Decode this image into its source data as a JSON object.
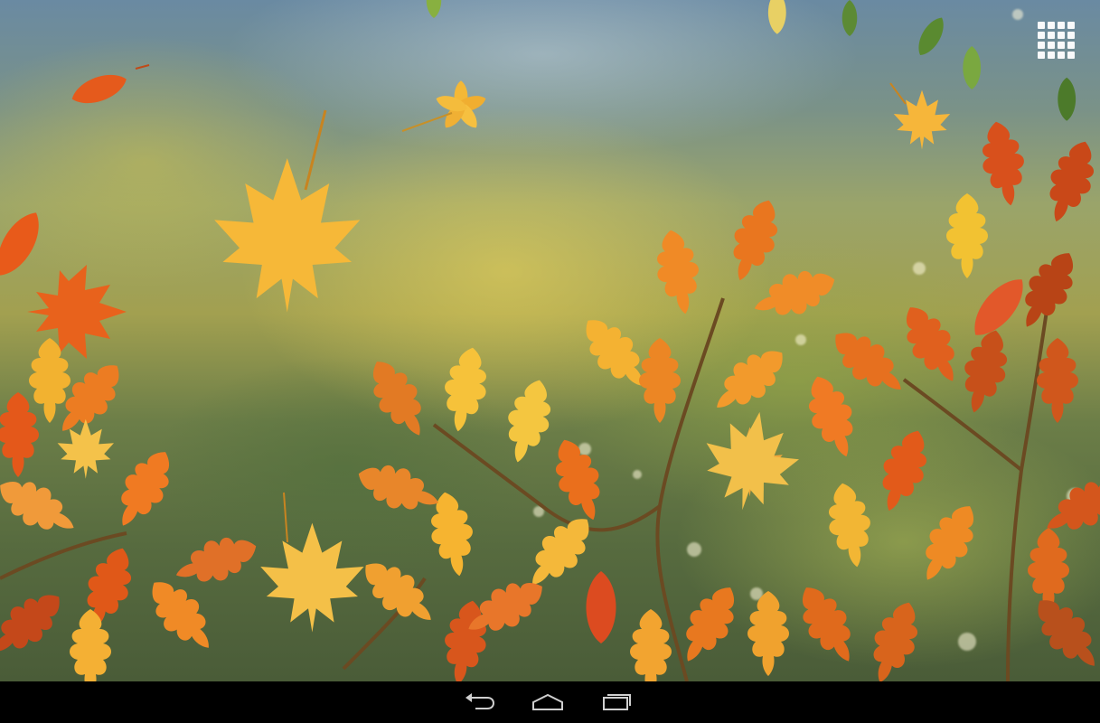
{
  "screen": {
    "type": "android-tablet-home",
    "wallpaper": "autumn-leaves-live-wallpaper"
  },
  "launcher": {
    "all_apps_icon": "grid-icon"
  },
  "nav_bar": {
    "background": "#000000",
    "icon_color": "#cfcfcf",
    "buttons": [
      {
        "name": "back",
        "icon": "back-arrow-icon"
      },
      {
        "name": "home",
        "icon": "home-icon"
      },
      {
        "name": "recents",
        "icon": "recent-apps-icon"
      }
    ]
  },
  "colors": {
    "leaf_orange": "#e8651c",
    "leaf_gold": "#f2b234",
    "leaf_red": "#d8431a",
    "leaf_yellow": "#f6c84a"
  }
}
